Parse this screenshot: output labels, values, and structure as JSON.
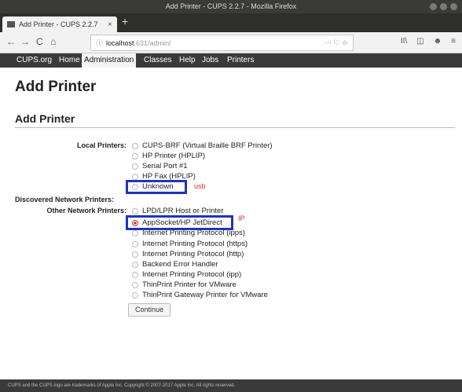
{
  "window": {
    "title": "Add Printer - CUPS 2.2.7 - Mozilla Firefox"
  },
  "tab": {
    "title": "Add Printer - CUPS 2.2.7",
    "close": "×",
    "new": "+"
  },
  "nav": {
    "back": "←",
    "forward": "→",
    "reload": "C",
    "home": "⌂",
    "url_host": "localhost",
    "url_path": ":631/admin/",
    "url_info": "ⓘ",
    "url_actions": "··· ♡ ☆",
    "tools": [
      "II\\",
      "◫",
      "☻",
      "≡"
    ]
  },
  "cups_nav": {
    "items": [
      "CUPS.org",
      "Home",
      "Administration",
      "Classes",
      "Help",
      "Jobs",
      "Printers"
    ]
  },
  "page": {
    "title": "Add Printer",
    "section": "Add Printer"
  },
  "groups": {
    "local": "Local Printers:",
    "discovered": "Discovered Network Printers:",
    "other": "Other Network Printers:"
  },
  "local_printers": [
    "CUPS-BRF (Virtual Braille BRF Printer)",
    "HP Printer (HPLIP)",
    "Serial Port #1",
    "HP Fax (HPLIP)",
    "Unknown"
  ],
  "other_printers": [
    "LPD/LPR Host or Printer",
    "AppSocket/HP JetDirect",
    "Internet Printing Protocol (ipps)",
    "Internet Printing Protocol (https)",
    "Internet Printing Protocol (http)",
    "Backend Error Handler",
    "Internet Printing Protocol (ipp)",
    "ThinPrint Printer for VMware",
    "ThinPrint Gateway Printer for VMware"
  ],
  "selected_printer": "AppSocket/HP JetDirect",
  "annotations": {
    "usb": "usb",
    "ip": "IP"
  },
  "continue_label": "Continue",
  "footer": "CUPS and the CUPS logo are trademarks of Apple Inc. Copyright © 2007-2017 Apple Inc. All rights reserved.",
  "colors": {
    "annotation_box": "#2233bb",
    "annotation_text": "#d03030",
    "nav_bg": "#3a3a3a"
  }
}
